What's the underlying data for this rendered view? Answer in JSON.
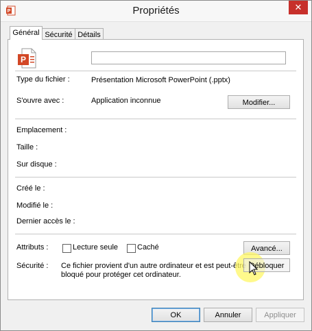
{
  "window": {
    "title": "Propriétés",
    "close_glyph": "✕",
    "icon": "powerpoint-icon"
  },
  "tabs": [
    {
      "label": "Général",
      "active": true
    },
    {
      "label": "Sécurité",
      "active": false
    },
    {
      "label": "Détails",
      "active": false
    }
  ],
  "general": {
    "file_name_value": "",
    "file_type_label": "Type du fichier :",
    "file_type_value": "Présentation Microsoft PowerPoint (.pptx)",
    "opens_with_label": "S'ouvre avec :",
    "opens_with_value": "Application inconnue",
    "change_button": "Modifier...",
    "location_label": "Emplacement :",
    "size_label": "Taille :",
    "size_on_disk_label": "Sur disque :",
    "created_label": "Créé le :",
    "modified_label": "Modifié le :",
    "accessed_label": "Dernier accès le :",
    "attributes_label": "Attributs :",
    "readonly_label": "Lecture seule",
    "hidden_label": "Caché",
    "advanced_button": "Avancé...",
    "security_label": "Sécurité :",
    "security_text_line1": "Ce fichier provient d'un autre ordinateur et est peut-être",
    "security_text_line2": "bloqué pour protéger cet ordinateur.",
    "unblock_button": "Débloquer"
  },
  "footer": {
    "ok": "OK",
    "cancel": "Annuler",
    "apply": "Appliquer"
  },
  "colors": {
    "close_button": "#c7302b",
    "powerpoint_orange": "#d24726",
    "cursor_highlight": "#fff766"
  }
}
